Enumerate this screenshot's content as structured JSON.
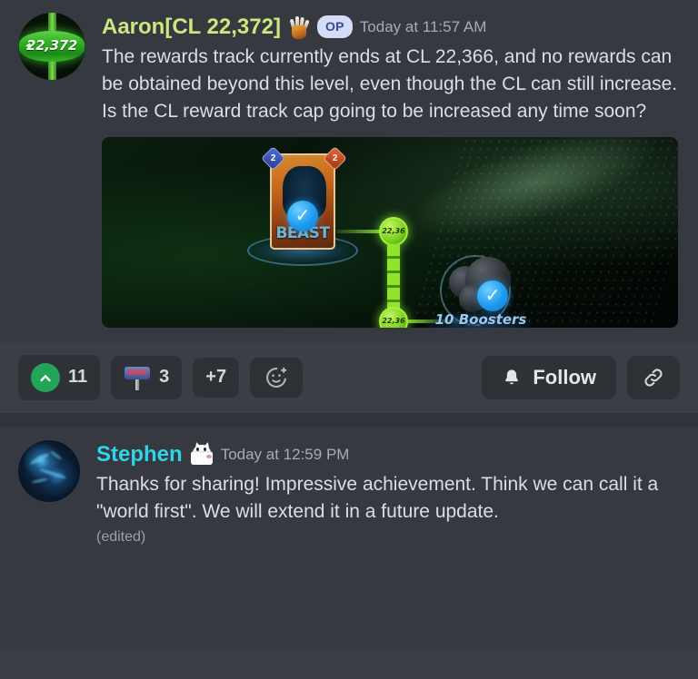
{
  "messages": [
    {
      "id": "aaron-message",
      "username": "Aaron[CL 22,372]",
      "username_color": "#c9e87f",
      "badges": {
        "role": "OP",
        "emoji_name": "raised-claw-emoji"
      },
      "timestamp": "Today at 11:57 AM",
      "avatar": {
        "name": "aaron-avatar",
        "badge_value": "22,372",
        "spark_glyph": "✦",
        "accent_color": "#2faf23"
      },
      "text": "The rewards track currently ends at CL 22,366, and no rewards can be obtained beyond this level, even though the CL can still increase. Is the  CL reward track cap going to be increased any time soon?",
      "embed": {
        "name": "rewards-track-screenshot",
        "card_name": "BEAST",
        "card_cost": "2",
        "card_power": "2",
        "node_top_label": "22,36",
        "node_bottom_label": "22,36",
        "reward_label": "10 Boosters"
      }
    },
    {
      "id": "stephen-message",
      "username": "Stephen",
      "username_color": "#2fd4e8",
      "badges": {
        "emoji_name": "white-creature-emoji"
      },
      "timestamp": "Today at 12:59 PM",
      "avatar": {
        "name": "stephen-avatar"
      },
      "text": "Thanks for sharing!  Impressive achievement.  Think we can call it a \"world first\".  We will extend it in a future update.",
      "edited_label": "(edited)"
    }
  ],
  "reaction_bar": {
    "reactions": [
      {
        "name": "upvote-reaction",
        "icon": "upvote-arrow-icon",
        "count": "11"
      },
      {
        "name": "ban-hammer-reaction",
        "icon": "ban-hammer-emoji",
        "emoji_text": "BAN",
        "count": "3"
      },
      {
        "name": "more-reactions",
        "label": "+7"
      }
    ],
    "add_reaction_icon": "add-reaction-icon",
    "follow_label": "Follow",
    "follow_icon": "bell-icon",
    "link_icon": "link-icon"
  },
  "colors": {
    "background": "#36393f",
    "reaction_bar_background": "#3b3e45",
    "chip_background": "#2e3136",
    "text": "#dcdee3",
    "muted_text": "#a6acb6",
    "upvote_green": "#23a559",
    "op_badge_background": "#d6dcf7",
    "op_badge_text": "#3a4a8f"
  }
}
